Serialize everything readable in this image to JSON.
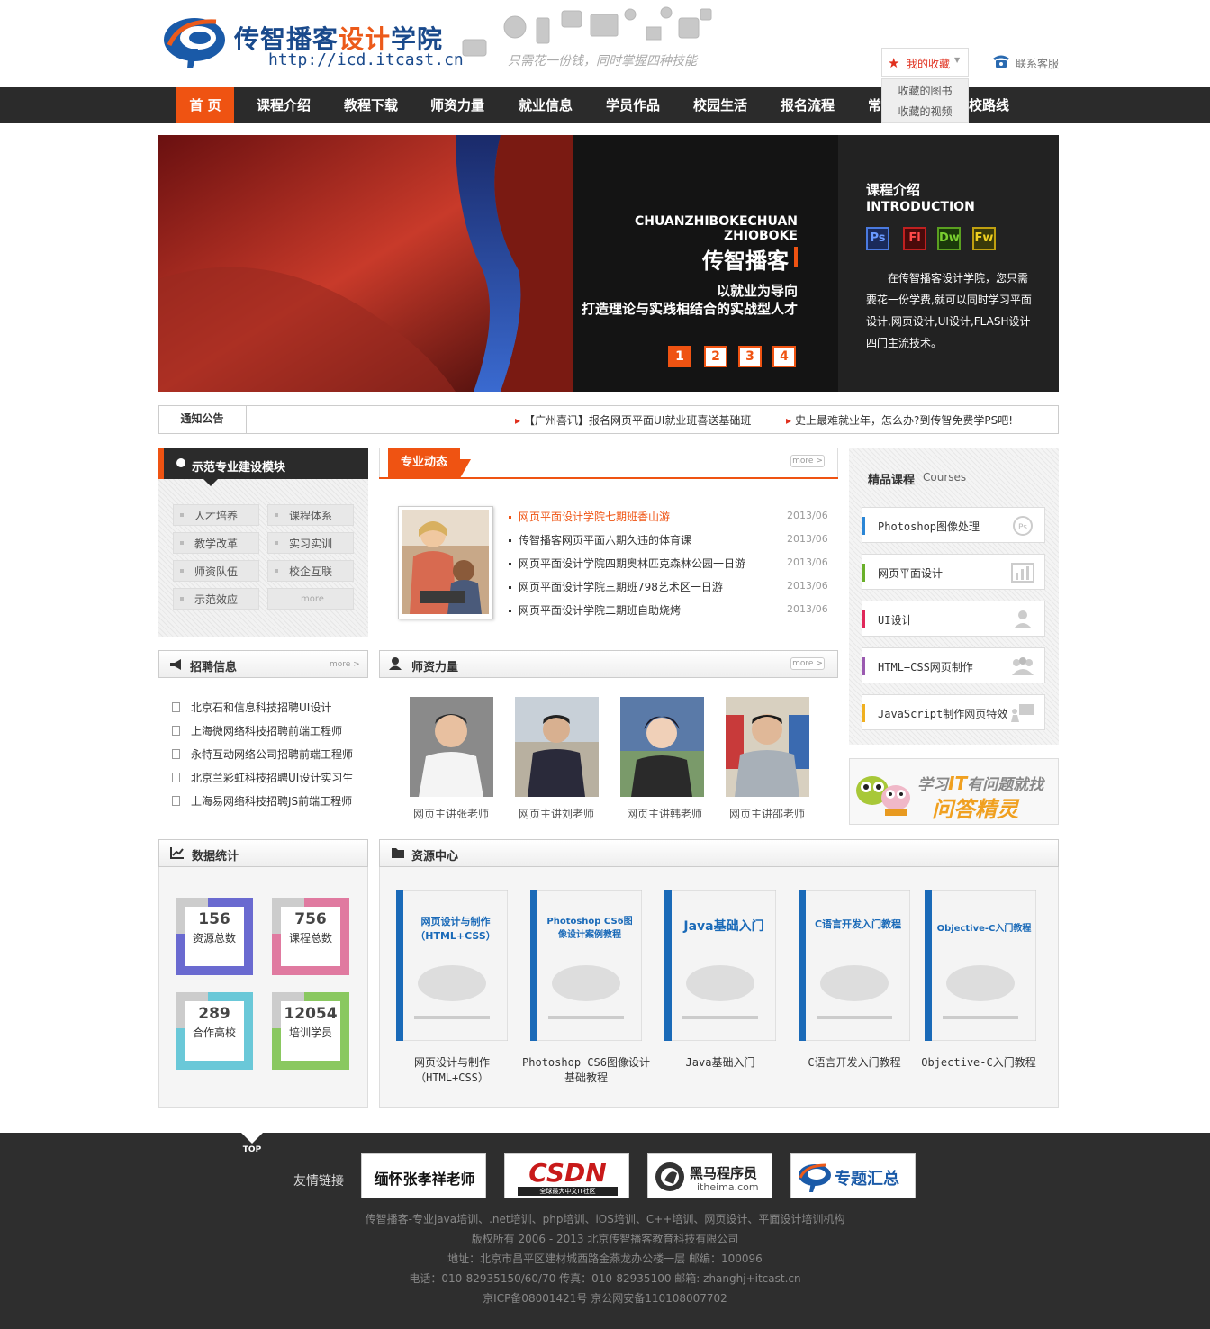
{
  "header": {
    "logo_title_a": "传智播客",
    "logo_title_b": "设计",
    "logo_title_c": "学院",
    "logo_url": "http://icd.itcast.cn",
    "slogan": "只需花一份钱，同时掌握四种技能",
    "favorites": {
      "label": "我的收藏",
      "items": [
        "收藏的图书",
        "收藏的视频"
      ]
    },
    "contact": "联系客服"
  },
  "nav": {
    "items": [
      "首 页",
      "课程介绍",
      "教程下载",
      "师资力量",
      "就业信息",
      "学员作品",
      "校园生活",
      "报名流程",
      "常",
      "校路线"
    ]
  },
  "banner": {
    "en_line1": "CHUANZHIBOKECHUAN",
    "en_line2": "ZHIOBOKE",
    "cn_title": "传智播客",
    "sub1": "以就业为导向",
    "sub2": "打造理论与实践相结合的实战型人才",
    "pages": [
      "1",
      "2",
      "3",
      "4"
    ],
    "active_page": 1
  },
  "intro": {
    "title": "课程介绍",
    "subtitle": "INTRODUCTION",
    "apps": [
      "Ps",
      "Fl",
      "Dw",
      "Fw"
    ],
    "text": "在传智播客设计学院，您只需要花一份学费,就可以同时学习平面设计,网页设计,UI设计,FLASH设计四门主流技术。"
  },
  "notice": {
    "title": "通知公告",
    "items": [
      "【广州喜讯】报名网页平面UI就业班喜送基础班",
      "史上最难就业年，怎么办?到传智免费学PS吧!"
    ]
  },
  "module": {
    "title": "示范专业建设模块",
    "buttons": [
      "人才培养",
      "课程体系",
      "教学改革",
      "实习实训",
      "师资队伍",
      "校企互联",
      "示范效应",
      "more"
    ]
  },
  "news": {
    "tab": "专业动态",
    "more": "more >",
    "items": [
      {
        "title": "网页平面设计学院七期班香山游",
        "date": "2013/06"
      },
      {
        "title": "传智播客网页平面六期久违的体育课",
        "date": "2013/06"
      },
      {
        "title": "网页平面设计学院四期奥林匹克森林公园一日游",
        "date": "2013/06"
      },
      {
        "title": "网页平面设计学院三期班798艺术区一日游",
        "date": "2013/06"
      },
      {
        "title": "网页平面设计学院二期班自助烧烤",
        "date": "2013/06"
      }
    ]
  },
  "recruit": {
    "title": "招聘信息",
    "more": "more >",
    "items": [
      "北京石和信息科技招聘UI设计",
      "上海微网络科技招聘前端工程师",
      "永特互动网络公司招聘前端工程师",
      "北京兰彩虹科技招聘UI设计实习生",
      "上海易网络科技招聘JS前端工程师"
    ]
  },
  "teachers": {
    "title": "师资力量",
    "more": "more >",
    "items": [
      "网页主讲张老师",
      "网页主讲刘老师",
      "网页主讲韩老师",
      "网页主讲邵老师"
    ]
  },
  "courses": {
    "title": "精品课程",
    "title_en": "Courses",
    "items": [
      {
        "label": "Photoshop图像处理",
        "color": "#2a86d6"
      },
      {
        "label": "网页平面设计",
        "color": "#6ab02a"
      },
      {
        "label": "UI设计",
        "color": "#e0285a"
      },
      {
        "label": "HTML+CSS网页制作",
        "color": "#9a5ab0"
      },
      {
        "label": "JavaScript制作网页特效",
        "color": "#f0b020"
      }
    ]
  },
  "qa": {
    "line1a": "学习",
    "line1b": "IT",
    "line1c": "有问题就找",
    "line2": "问答精灵"
  },
  "stats": {
    "title": "数据统计",
    "items": [
      {
        "num": "156",
        "label": "资源总数",
        "color": "#6a6ad0"
      },
      {
        "num": "756",
        "label": "课程总数",
        "color": "#e07aa0"
      },
      {
        "num": "289",
        "label": "合作高校",
        "color": "#6ac8d8"
      },
      {
        "num": "12054",
        "label": "培训学员",
        "color": "#8ac860"
      }
    ]
  },
  "resources": {
    "title": "资源中心",
    "books": [
      {
        "name": "网页设计与制作（HTML+CSS）",
        "cover_title": "网页设计与制作（HTML+CSS）"
      },
      {
        "name": "Photoshop CS6图像设计基础教程",
        "cover_title": "Photoshop CS6图像设计案例教程"
      },
      {
        "name": "Java基础入门",
        "cover_title": "Java基础入门"
      },
      {
        "name": "C语言开发入门教程",
        "cover_title": "C语言开发入门教程"
      },
      {
        "name": "Objective-C入门教程",
        "cover_title": "Objective-C入门教程"
      }
    ]
  },
  "footer": {
    "top": "TOP",
    "friend_label": "友情链接",
    "links": [
      "缅怀张孝祥老师",
      "CSDN",
      "黑马程序员",
      "专题汇总"
    ],
    "csdn_sub": "全球最大中文IT社区",
    "heima_sub": "itheima.com",
    "lines": [
      "传智播客-专业java培训、.net培训、php培训、iOS培训、C++培训、网页设计、平面设计培训机构",
      "版权所有 2006 - 2013 北京传智播客教育科技有限公司",
      "地址：北京市昌平区建材城西路金燕龙办公楼一层 邮编：100096",
      "电话：010-82935150/60/70 传真：010-82935100 邮箱: zhanghj+itcast.cn",
      "京ICP备08001421号 京公网安备110108007702"
    ]
  }
}
